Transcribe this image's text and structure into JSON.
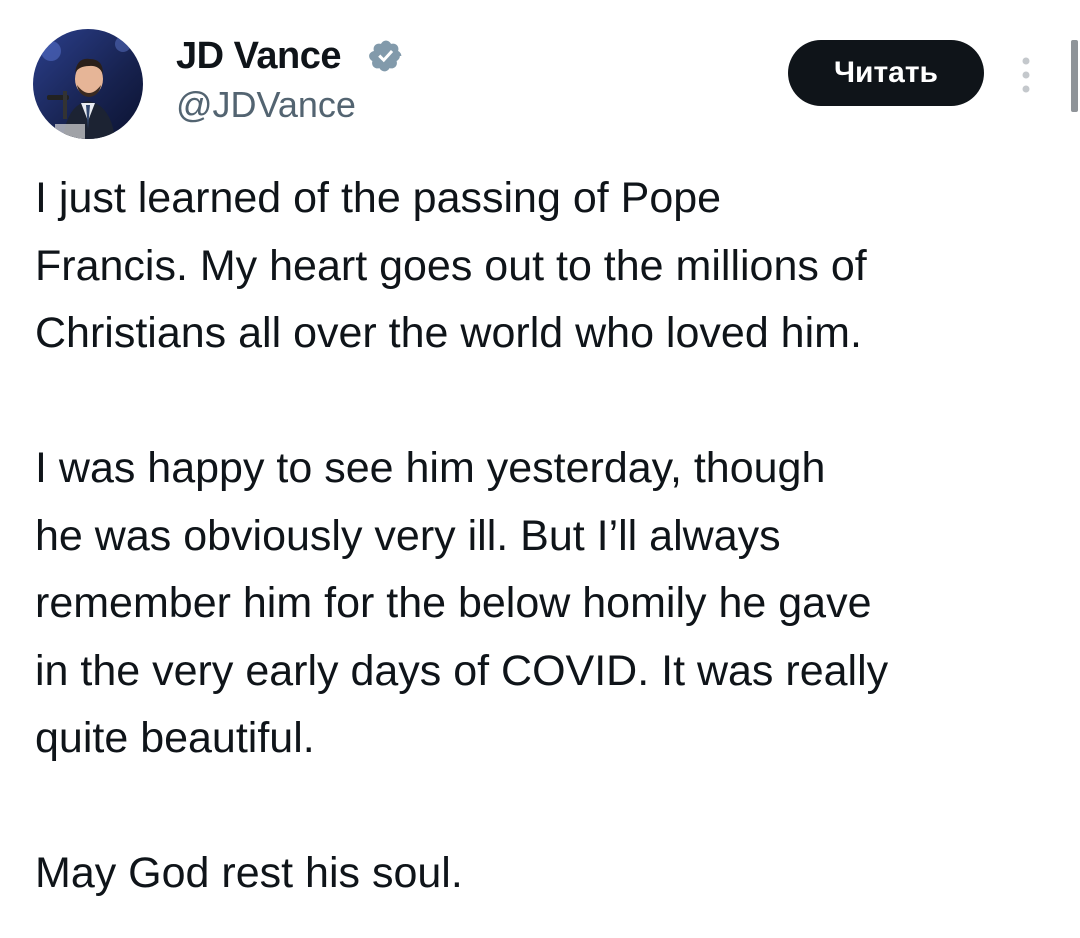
{
  "author": {
    "display_name": "JD Vance",
    "handle": "@JDVance",
    "verified": true,
    "verified_color": "#829aab",
    "avatar_icon": "profile-photo"
  },
  "actions": {
    "follow_label": "Читать",
    "more_icon": "vertical-ellipsis-icon"
  },
  "tweet": {
    "lines": [
      "I just learned of the passing of Pope",
      "Francis. My heart goes out to the millions of",
      "Christians all over the world who loved him.",
      "",
      "I was happy to see him yesterday, though",
      "he was obviously very ill. But I’ll always",
      "remember him for the below homily he gave",
      "in the very early days of COVID. It was really",
      "quite beautiful.",
      "",
      "May God rest his soul."
    ]
  },
  "colors": {
    "text_primary": "#0f1419",
    "text_secondary": "#536471",
    "button_bg": "#0f1419",
    "button_text": "#ffffff"
  }
}
